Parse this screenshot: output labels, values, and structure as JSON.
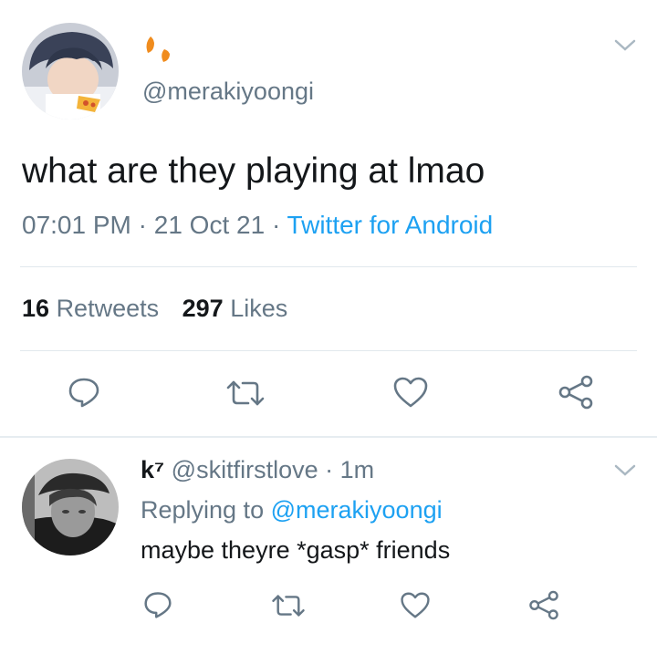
{
  "tweet": {
    "display_name_icon": "leaf-emoji",
    "handle": "@merakiyoongi",
    "text": "what are they playing at lmao",
    "time": "07:01 PM",
    "sep1": "·",
    "date": "21 Oct 21",
    "sep2": "·",
    "source": "Twitter for Android",
    "retweets_count": "16",
    "retweets_label": "Retweets",
    "likes_count": "297",
    "likes_label": "Likes"
  },
  "reply": {
    "name": "k⁷",
    "handle": "@skitfirstlove",
    "sep": "·",
    "time": "1m",
    "replying_prefix": "Replying to",
    "replying_handle": "@merakiyoongi",
    "text": "maybe theyre *gasp* friends"
  },
  "colors": {
    "accent": "#1da1f2",
    "muted": "#657786",
    "text": "#14171a",
    "leaf": "#f08c1e"
  }
}
